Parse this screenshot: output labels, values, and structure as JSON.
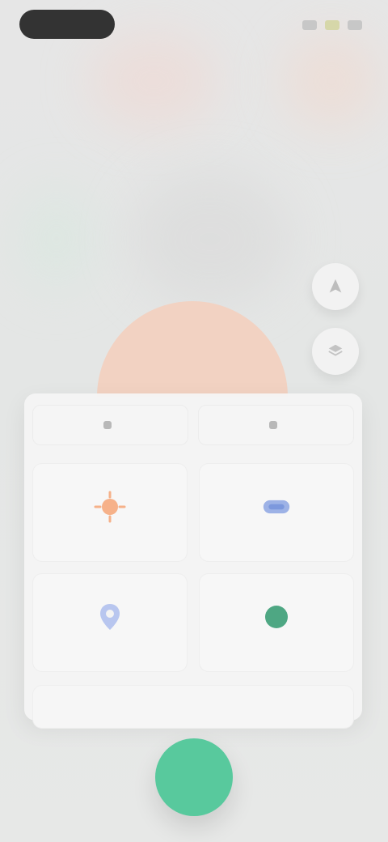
{
  "status": {
    "time": "",
    "icons": [
      "signal-icon",
      "wifi-icon",
      "battery-icon"
    ]
  },
  "side_buttons": [
    {
      "icon": "location-icon"
    },
    {
      "icon": "layers-icon"
    }
  ],
  "arc": {
    "label": ""
  },
  "panel": {
    "tabs": [
      {
        "label": "",
        "icon": "tab-icon"
      },
      {
        "label": "",
        "icon": "tab-icon"
      }
    ],
    "cards": [
      {
        "label": "",
        "icon": "sun-icon"
      },
      {
        "label": "",
        "icon": "card-icon"
      },
      {
        "label": "",
        "icon": "map-pin-icon"
      },
      {
        "label": "",
        "icon": "circle-icon"
      }
    ],
    "bottom_action": {
      "label": ""
    }
  },
  "fab": {
    "label": ""
  },
  "colors": {
    "accent_green": "#58c99d",
    "peach": "#f2d2c2",
    "orange": "#f4a46f",
    "blue": "#7c98dd",
    "green": "#4ea783"
  }
}
